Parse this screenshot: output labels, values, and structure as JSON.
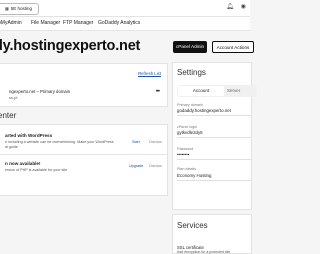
{
  "topbar": {
    "hosting_label": "5E hosting",
    "hosting_icon": "grid-icon"
  },
  "nav": {
    "items": [
      {
        "label": "pMyAdmin"
      },
      {
        "label": "File Manager"
      },
      {
        "label": "FTP Manager"
      },
      {
        "label": "GoDaddy Analytics"
      }
    ]
  },
  "header": {
    "domain": "dy.hostingexperto.net",
    "cpanel_button": "cPanel Admin",
    "account_actions_button": "Account Actions"
  },
  "domains_card": {
    "refresh_link": "Refresh List",
    "domain_row": "ngexperto.net – Primary domain",
    "domain_row_sub": "ss.pt",
    "more_icon": "kebab-icon"
  },
  "center": {
    "title": "enter",
    "items": [
      {
        "title": "arted with WordPress",
        "desc": "n including a website can be overwhelming. Make your WordPress",
        "desc2": "al guide",
        "action": "Start",
        "dismiss": "Dismiss"
      },
      {
        "title": "n now available!",
        "desc": "ersion of PHP is available for your site",
        "action": "Upgrade",
        "dismiss": "Dismiss"
      }
    ]
  },
  "settings": {
    "title": "Settings",
    "tabs": [
      {
        "label": "Account",
        "active": true
      },
      {
        "label": "Server",
        "active": false
      }
    ],
    "fields": [
      {
        "label": "Primary domain",
        "value": "godaddy.hostingexperto.net"
      },
      {
        "label": "cPanel login",
        "value": "gytkvdle2dy5"
      },
      {
        "label": "Password",
        "value": "••••••••"
      },
      {
        "label": "Plan details",
        "value": "Economy Hosting"
      }
    ]
  },
  "services": {
    "title": "Services",
    "ssl_title": "SSL certificate",
    "ssl_desc": "Add encryption for a protected site"
  },
  "colors": {
    "link": "#1a4ea2",
    "dark_button": "#111111",
    "background": "#f5f5f5"
  }
}
